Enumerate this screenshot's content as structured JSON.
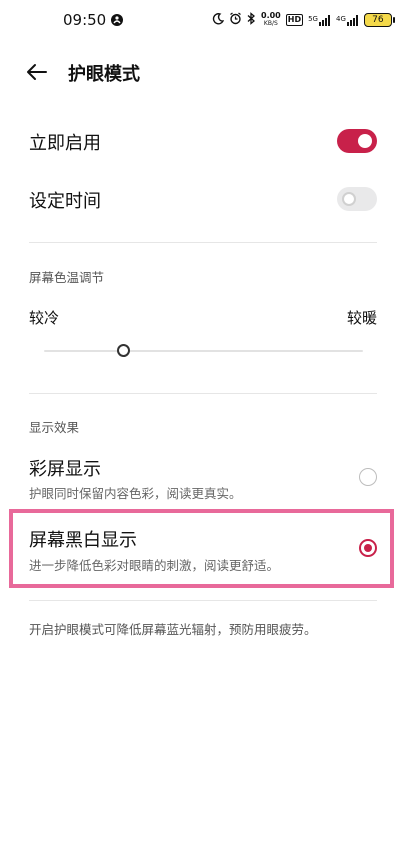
{
  "status_bar": {
    "time": "09:50",
    "net_speed_value": "0.00",
    "net_speed_unit": "KB/S",
    "hd_label": "HD",
    "sim1_label": "5G",
    "sim2_label": "4G",
    "battery": "76",
    "battery_color": "#f4d94a"
  },
  "header": {
    "title": "护眼模式"
  },
  "settings": {
    "enable_now": {
      "label": "立即启用",
      "enabled": true
    },
    "schedule": {
      "label": "设定时间",
      "enabled": false
    }
  },
  "color_temp": {
    "section_title": "屏幕色温调节",
    "min_label": "较冷",
    "max_label": "较暖",
    "level": 0.25
  },
  "display_effect": {
    "section_title": "显示效果",
    "options": [
      {
        "title": "彩屏显示",
        "subtitle": "护眼同时保留内容色彩，阅读更真实。",
        "selected": false
      },
      {
        "title": "屏幕黑白显示",
        "subtitle": "进一步降低色彩对眼睛的刺激，阅读更舒适。",
        "selected": true
      }
    ]
  },
  "footer_note": "开启护眼模式可降低屏幕蓝光辐射，预防用眼疲劳。",
  "colors": {
    "accent": "#c8214a",
    "highlight": "#e8699a"
  }
}
